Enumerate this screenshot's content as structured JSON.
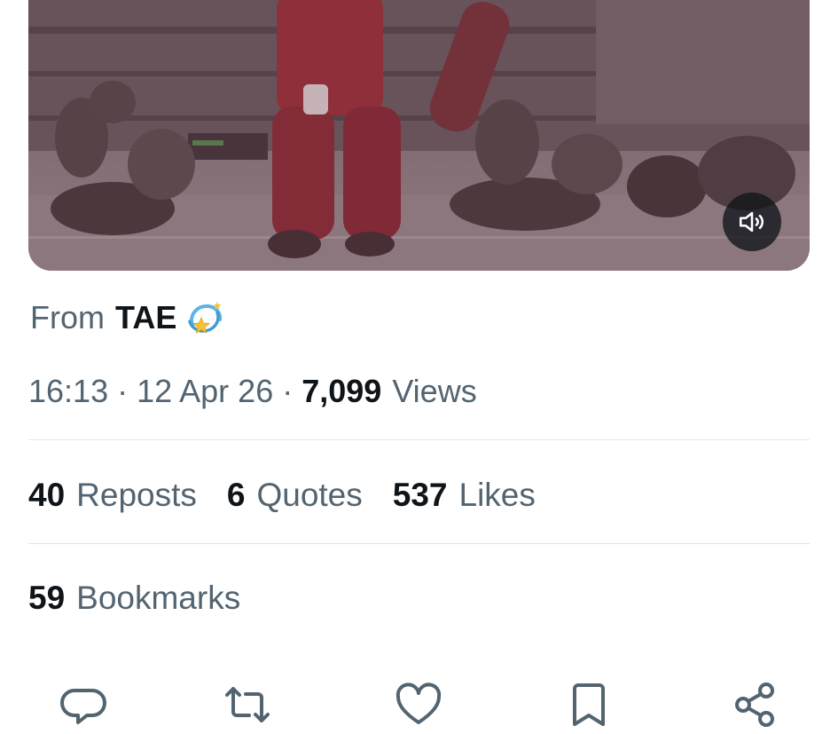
{
  "tweet": {
    "source_prefix": "From",
    "source_name": "TAE",
    "time": "16:13",
    "separator": "·",
    "date": "12 Apr 26",
    "views_count": "7,099",
    "views_label": "Views"
  },
  "stats": [
    {
      "count": "40",
      "label": "Reposts"
    },
    {
      "count": "6",
      "label": "Quotes"
    },
    {
      "count": "537",
      "label": "Likes"
    },
    {
      "count": "59",
      "label": "Bookmarks"
    }
  ],
  "icons": {
    "sound": "speaker-muted-icon",
    "emoji": "dizzy-star-emoji",
    "actions": [
      "reply-icon",
      "repost-icon",
      "like-icon",
      "bookmark-icon",
      "share-icon"
    ]
  },
  "colors": {
    "text_primary": "#0f1419",
    "text_secondary": "#536471",
    "divider": "#e1e6ea",
    "video_tint": "#8b2a34"
  }
}
